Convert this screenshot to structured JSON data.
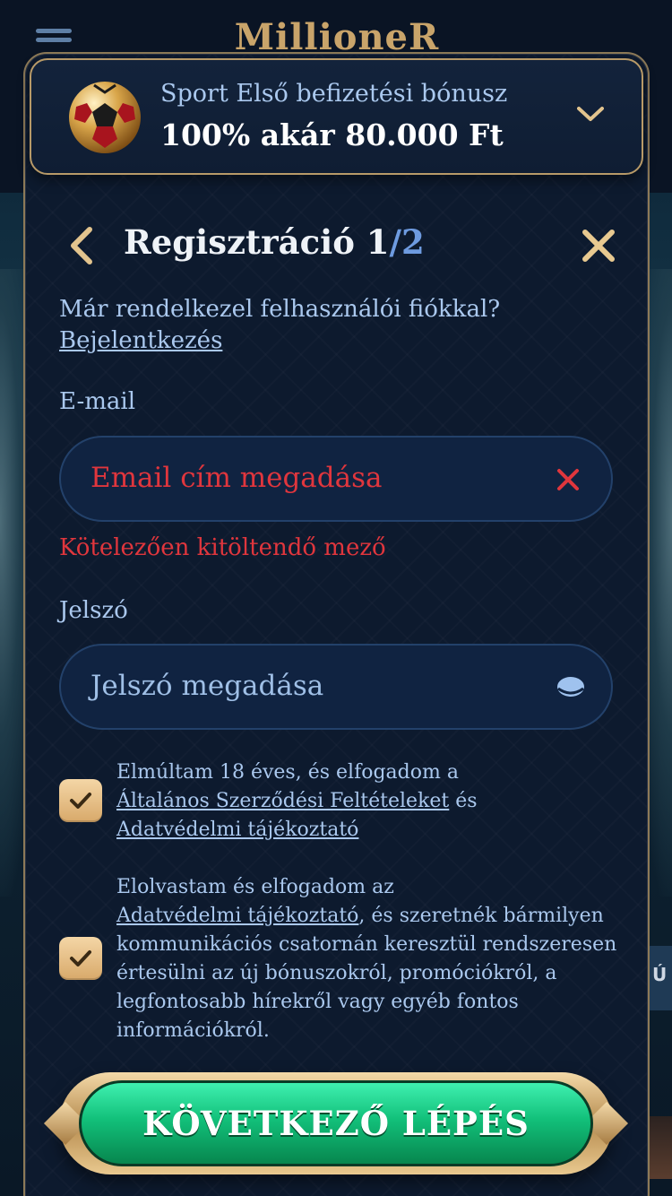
{
  "background": {
    "logo_text": "MillioneR",
    "side_tab_text": "Ú"
  },
  "bonus": {
    "title": "Sport Első befizetési bónusz",
    "amount": "100% akár 80.000 Ft",
    "icon": "soccer-ball-icon",
    "expand_icon": "chevron-down-icon"
  },
  "header": {
    "title_prefix": "Regisztráció 1",
    "title_suffix": "/2",
    "back_icon": "chevron-left-icon",
    "close_icon": "close-icon"
  },
  "login_prompt": {
    "text": "Már rendelkezel felhasználói fiókkal?",
    "link": "Bejelentkezés"
  },
  "email": {
    "label": "E-mail",
    "placeholder": "Email cím megadása",
    "error": "Kötelezően kitöltendő mező",
    "clear_icon": "clear-x-icon"
  },
  "password": {
    "label": "Jelszó",
    "placeholder": "Jelszó megadása",
    "toggle_icon": "eye-icon"
  },
  "consents": [
    {
      "checked": true,
      "text_1": "Elmúltam 18 éves, és elfogadom a",
      "link_1": "Általános Szerződési Feltételeket",
      "text_2": "és",
      "link_2": "Adatvédelmi tájékoztató"
    },
    {
      "checked": true,
      "text_1": "Elolvastam és elfogadom az",
      "link_1": "Adatvédelmi tájékoztató",
      "text_2": ", és szeretnék bármilyen kommunikációs csatornán keresztül rendszeresen értesülni az új bónuszokról, promóciókról, a legfontosabb hírekről vagy egyéb fontos információkról."
    }
  ],
  "cta": {
    "label": "KÖVETKEZŐ LÉPÉS"
  },
  "colors": {
    "accent_gold": "#c9a46a",
    "error_red": "#e0363d",
    "link_blue": "#aac8ee",
    "cta_green": "#12c07a"
  }
}
